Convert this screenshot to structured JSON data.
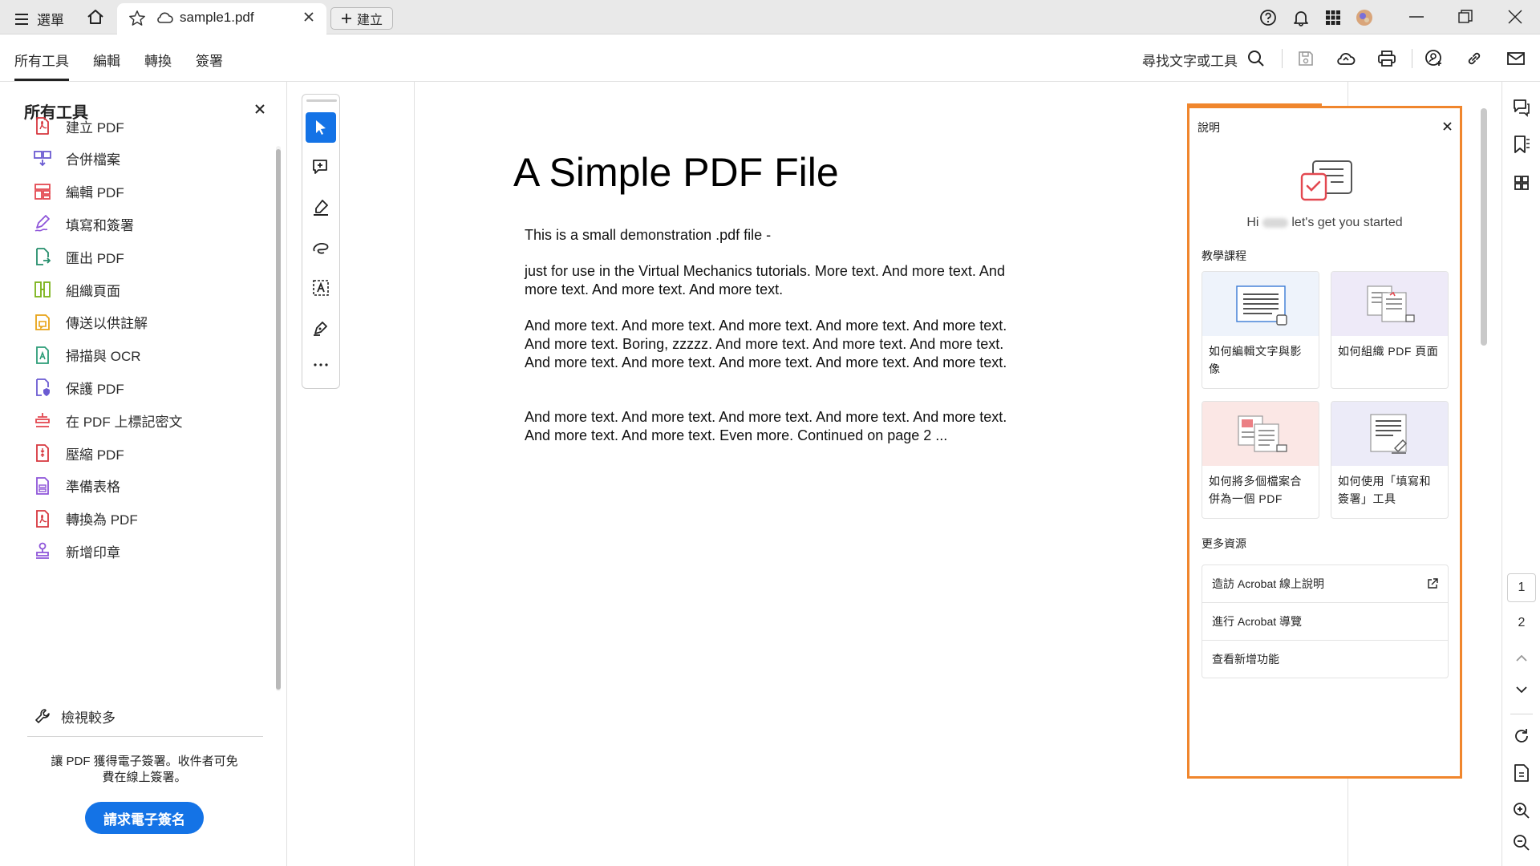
{
  "titlebar": {
    "menu_label": "選單",
    "tab_title": "sample1.pdf",
    "new_label": "建立"
  },
  "menubar": {
    "tabs": [
      "所有工具",
      "編輯",
      "轉換",
      "簽署"
    ],
    "search_label": "尋找文字或工具"
  },
  "leftpanel": {
    "title": "所有工具",
    "tools": [
      {
        "label": "建立 PDF",
        "icon": "create-pdf-icon",
        "color": "#d7373f"
      },
      {
        "label": "合併檔案",
        "icon": "combine-files-icon",
        "color": "#6b5bd2"
      },
      {
        "label": "編輯 PDF",
        "icon": "edit-pdf-icon",
        "color": "#e34850"
      },
      {
        "label": "填寫和簽署",
        "icon": "fill-sign-icon",
        "color": "#8e55d9"
      },
      {
        "label": "匯出 PDF",
        "icon": "export-pdf-icon",
        "color": "#268e6c"
      },
      {
        "label": "組織頁面",
        "icon": "organize-pages-icon",
        "color": "#7ab317"
      },
      {
        "label": "傳送以供註解",
        "icon": "send-comment-icon",
        "color": "#e8a317"
      },
      {
        "label": "掃描與 OCR",
        "icon": "scan-ocr-icon",
        "color": "#2d9d78"
      },
      {
        "label": "保護 PDF",
        "icon": "protect-pdf-icon",
        "color": "#6b5bd2"
      },
      {
        "label": "在 PDF 上標記密文",
        "icon": "redact-icon",
        "color": "#e34850"
      },
      {
        "label": "壓縮 PDF",
        "icon": "compress-pdf-icon",
        "color": "#d7373f"
      },
      {
        "label": "準備表格",
        "icon": "prepare-form-icon",
        "color": "#8e55d9"
      },
      {
        "label": "轉換為 PDF",
        "icon": "convert-pdf-icon",
        "color": "#d7373f"
      },
      {
        "label": "新增印章",
        "icon": "stamp-icon",
        "color": "#8e55d9"
      }
    ],
    "view_more": "檢視較多",
    "promo_text": "讓 PDF 獲得電子簽署。收件者可免費在線上簽署。",
    "promo_button": "請求電子簽名"
  },
  "document": {
    "title": "A Simple PDF File",
    "paragraphs": [
      "This is a small demonstration .pdf file -",
      "just for use in the Virtual Mechanics tutorials. More text. And more text. And more text. And more text. And more text.",
      "And more text. And more text. And more text. And more text. And more text. And more text. Boring, zzzzz. And more text. And more text. And more text. And more text. And more text. And more text. And more text. And more text.",
      "And more text. And more text. And more text. And more text. And more text. And more text. And more text. Even more. Continued on page 2 ..."
    ]
  },
  "help": {
    "title": "說明",
    "greeting_prefix": "Hi",
    "greeting_suffix": "let's get you started",
    "tutorials_heading": "教學課程",
    "cards": [
      {
        "caption": "如何編輯文字與影像",
        "bg": "#eef3fb"
      },
      {
        "caption": "如何組織 PDF 頁面",
        "bg": "#eeeaf8"
      },
      {
        "caption": "如何將多個檔案合併為一個 PDF",
        "bg": "#fbe7e5"
      },
      {
        "caption": "如何使用「填寫和簽署」工具",
        "bg": "#ecebf8"
      }
    ],
    "resources_heading": "更多資源",
    "resources": [
      "造訪 Acrobat 線上說明",
      "進行 Acrobat 導覽",
      "查看新增功能"
    ]
  },
  "rail": {
    "page_current": "1",
    "page_next": "2"
  },
  "colors": {
    "accent": "#1473e6",
    "help_border": "#f0862d"
  }
}
